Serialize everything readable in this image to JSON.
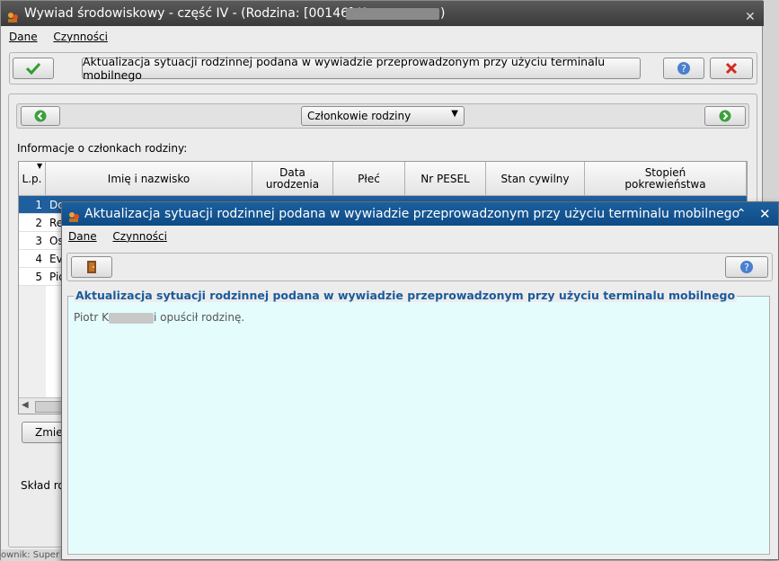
{
  "window": {
    "title": "Wywiad środowiskowy - część IV - (Rodzina: [00146] K",
    "title_end": ")",
    "menu": [
      "Dane",
      "Czynności"
    ],
    "toolbar_label": "Aktualizacja sytuacji rodzinnej podana w wywiadzie przeprowadzonym przy użyciu terminalu mobilnego",
    "nav_select": "Członkowie rodziny",
    "section_label": "Informacje o członkach rodziny:",
    "columns": [
      "L.p.",
      "Imię i nazwisko",
      "Data urodzenia",
      "Płeć",
      "Nr PESEL",
      "Stan cywilny",
      "Stopień pokrewieństwa"
    ],
    "rows": [
      {
        "lp": "1",
        "name": "Do"
      },
      {
        "lp": "2",
        "name": "Re"
      },
      {
        "lp": "3",
        "name": "Os"
      },
      {
        "lp": "4",
        "name": "Ev"
      },
      {
        "lp": "5",
        "name": "Pio"
      }
    ],
    "change_button": "Zmie",
    "footer_label": "Skład ro",
    "status_fragment": "ownik: Super"
  },
  "dialog": {
    "title": "Aktualizacja sytuacji rodzinnej podana w wywiadzie przeprowadzonym przy użyciu terminalu mobilnego",
    "menu": [
      "Dane",
      "Czynności"
    ],
    "group_title": "Aktualizacja sytuacji rodzinnej podana w wywiadzie przeprowadzonym przy użyciu terminalu mobilnego",
    "message_start": "Piotr K",
    "message_end": "i opuścił rodzinę."
  },
  "colors": {
    "accent": "#0f4b86",
    "selection": "#1f5f9e",
    "content_bg": "#e4fcfc",
    "ok_green": "#2e9e2e",
    "cancel_red": "#d22a1e"
  }
}
